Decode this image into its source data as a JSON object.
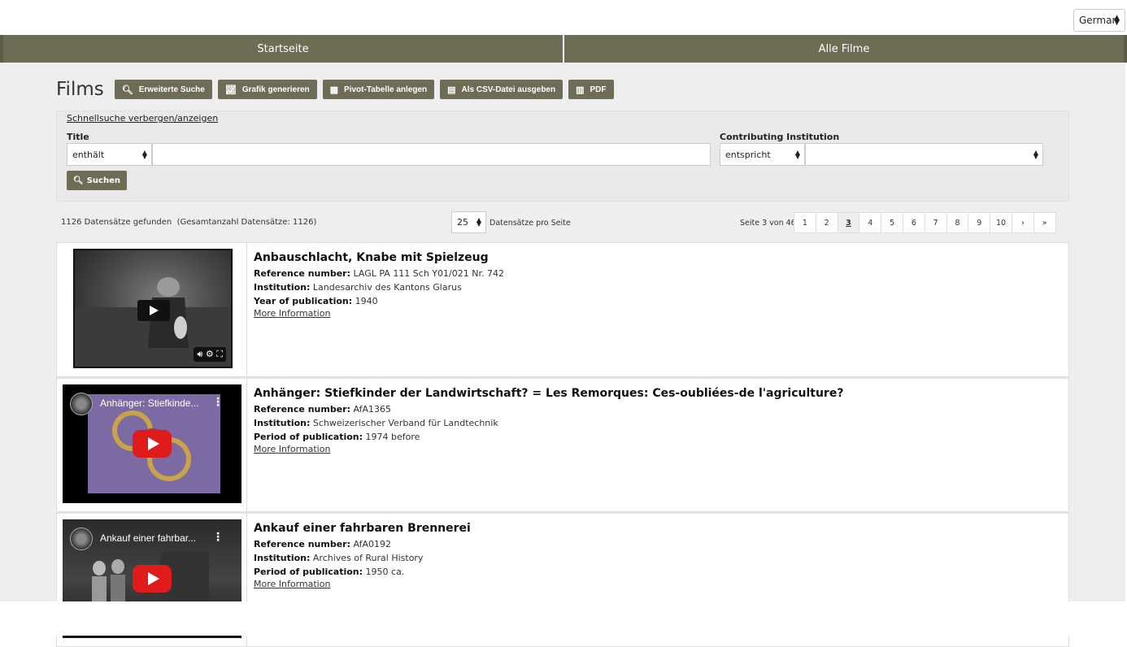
{
  "language": {
    "selected": "German"
  },
  "nav": {
    "home": "Startseite",
    "all_films": "Alle Filme"
  },
  "page": {
    "title": "Films",
    "buttons": {
      "advanced_search": "Erweiterte Suche",
      "chart": "Grafik generieren",
      "pivot": "Pivot-Tabelle anlegen",
      "csv": "Als CSV-Datei ausgeben",
      "pdf": "PDF"
    }
  },
  "quicksearch": {
    "toggle": "Schnellsuche verbergen/anzeigen",
    "title_label": "Title",
    "title_op": "enthält",
    "title_value": "",
    "inst_label": "Contributing Institution",
    "inst_op": "entspricht",
    "inst_value": "",
    "search_button": "Suchen"
  },
  "listing": {
    "found": "1126 Datensätze gefunden",
    "total": "(Gesamtanzahl Datensätze: 1126)",
    "per_page": "25",
    "per_page_label": "Datensätze pro Seite",
    "page_info": "Seite 3 von 46",
    "pages": [
      "1",
      "2",
      "3",
      "4",
      "5",
      "6",
      "7",
      "8",
      "9",
      "10",
      "›",
      "»"
    ],
    "active_page": "3"
  },
  "labels": {
    "ref": "Reference number:",
    "inst": "Institution:",
    "year": "Year of publication:",
    "period": "Period of publication:",
    "more": "More Information"
  },
  "results": [
    {
      "title": "Anbauschlacht, Knabe mit Spielzeug",
      "ref": "LAGL PA 111 Sch Y01/021 Nr. 742",
      "institution": "Landesarchiv des Kantons Glarus",
      "date": "1940"
    },
    {
      "title": "Anhänger: Stiefkinder der Landwirtschaft? = Les Remorques: Ces-oubliées-de l'agriculture?",
      "ref": "AfA1365",
      "institution": "Schweizerischer Verband für Landtechnik",
      "date": "1974 before",
      "video_title": "Anhänger: Stiefkinde..."
    },
    {
      "title": "Ankauf einer fahrbaren Brennerei",
      "ref": "AfA0192",
      "institution": "Archives of Rural History",
      "date": "1950 ca.",
      "video_title": "Ankauf einer fahrbar..."
    }
  ]
}
